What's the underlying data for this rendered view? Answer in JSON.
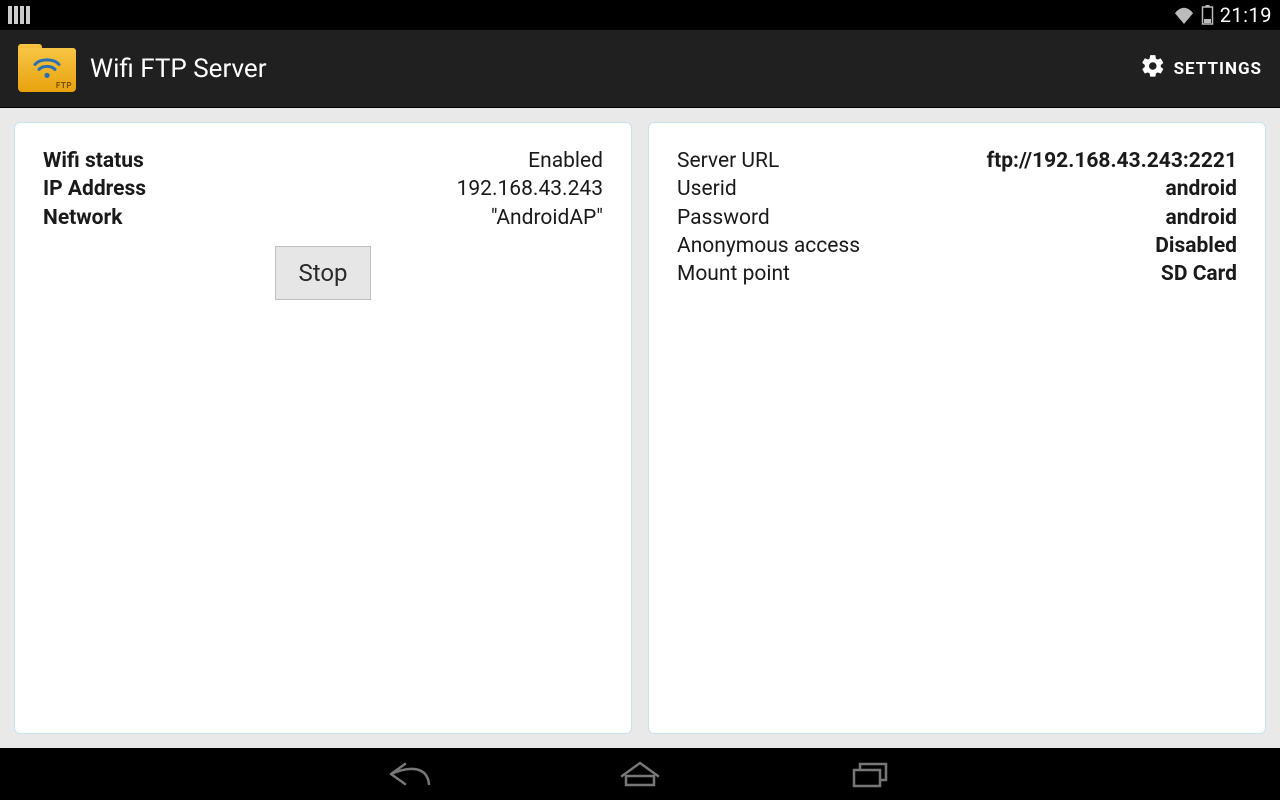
{
  "statusbar": {
    "clock": "21:19"
  },
  "actionbar": {
    "title": "Wifi FTP Server",
    "settings_label": "SETTINGS"
  },
  "left_panel": {
    "wifi_status_label": "Wifi status",
    "wifi_status_value": "Enabled",
    "ip_label": "IP Address",
    "ip_value": "192.168.43.243",
    "network_label": "Network",
    "network_value": "\"AndroidAP\"",
    "stop_button": "Stop"
  },
  "right_panel": {
    "url_label": "Server URL",
    "url_value": "ftp://192.168.43.243:2221",
    "userid_label": "Userid",
    "userid_value": "android",
    "password_label": "Password",
    "password_value": "android",
    "anon_label": "Anonymous access",
    "anon_value": "Disabled",
    "mount_label": "Mount point",
    "mount_value": "SD Card"
  }
}
